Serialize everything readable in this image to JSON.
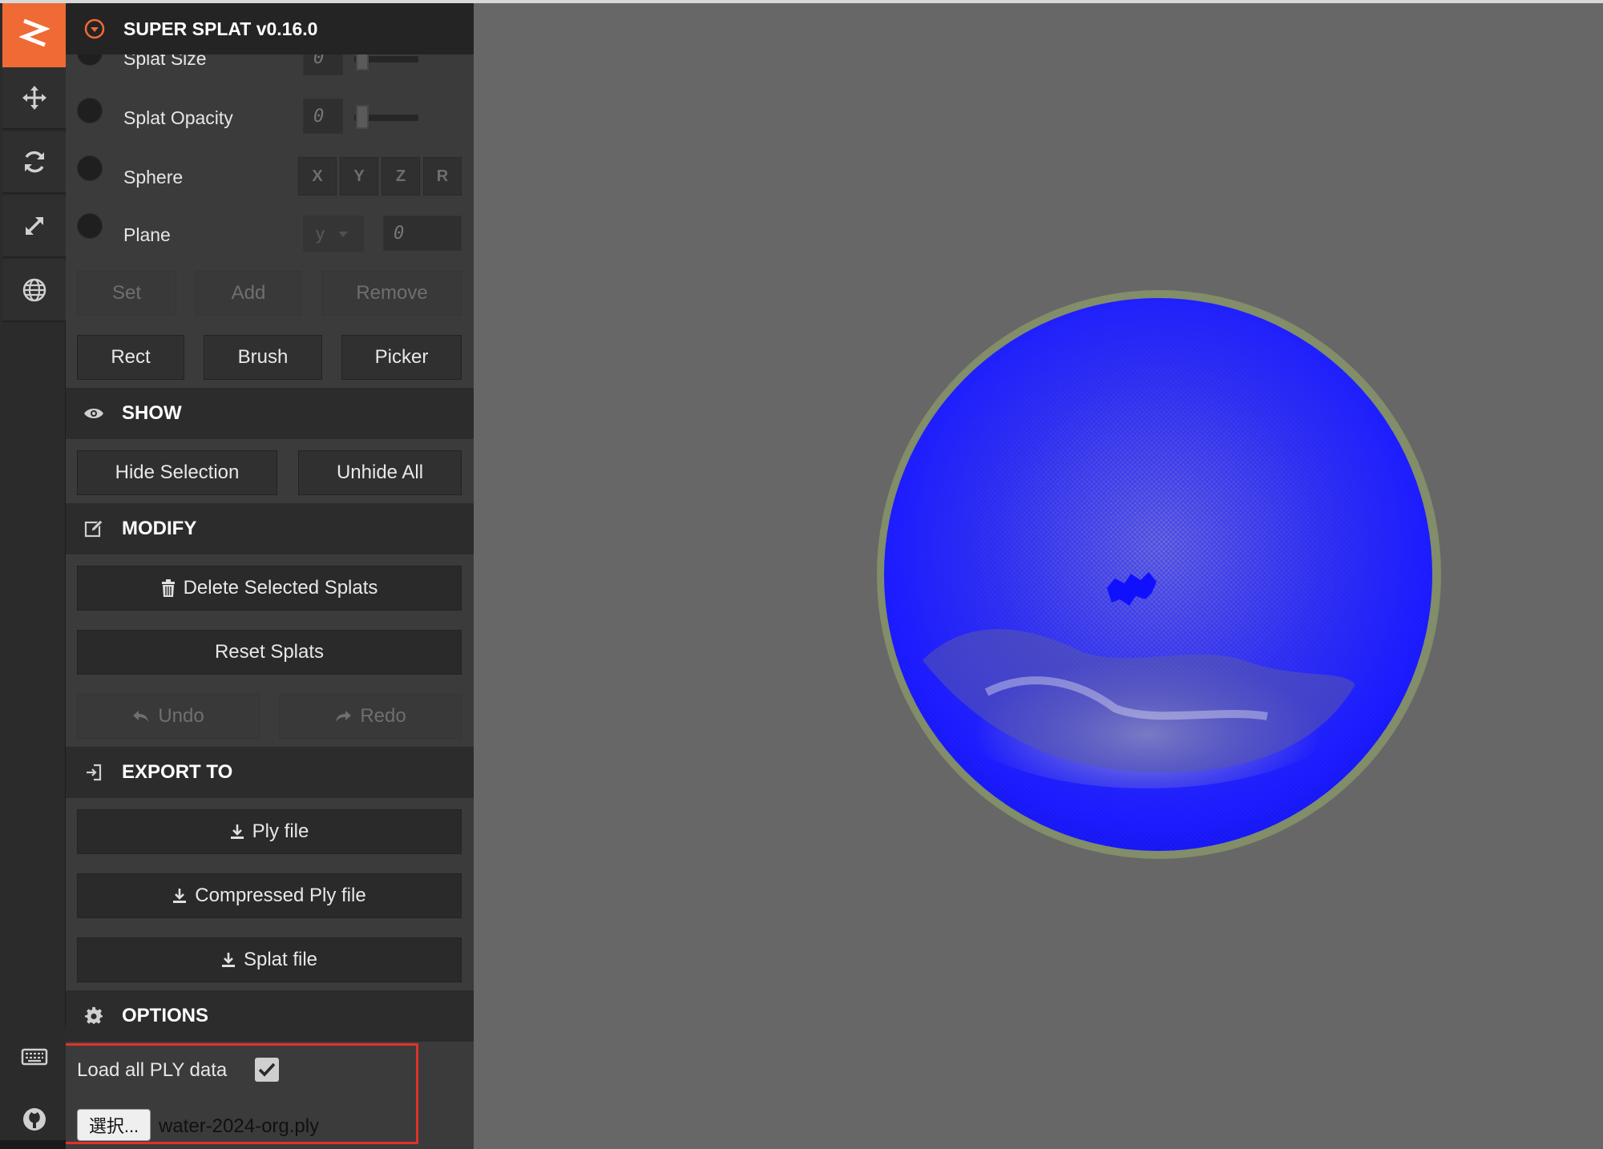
{
  "app": {
    "title": "SUPER SPLAT v0.16.0"
  },
  "toolbar": {
    "items": [
      {
        "icon": "move-icon"
      },
      {
        "icon": "rotate-icon"
      },
      {
        "icon": "scale-icon"
      },
      {
        "icon": "globe-icon"
      }
    ],
    "bottom": [
      {
        "icon": "keyboard-icon"
      },
      {
        "icon": "github-icon"
      }
    ]
  },
  "selection": {
    "splat_size": {
      "label": "Splat Size",
      "value": "0"
    },
    "splat_opacity": {
      "label": "Splat Opacity",
      "value": "0"
    },
    "sphere": {
      "label": "Sphere",
      "axes": [
        "X",
        "Y",
        "Z",
        "R"
      ]
    },
    "plane": {
      "label": "Plane",
      "axis": "y",
      "value": "0"
    },
    "actions": {
      "set": "Set",
      "add": "Add",
      "remove": "Remove"
    },
    "tools": {
      "rect": "Rect",
      "brush": "Brush",
      "picker": "Picker"
    }
  },
  "show": {
    "title": "SHOW",
    "hide_selection": "Hide Selection",
    "unhide_all": "Unhide All"
  },
  "modify": {
    "title": "MODIFY",
    "delete_selected": "Delete Selected Splats",
    "reset": "Reset Splats",
    "undo": "Undo",
    "redo": "Redo"
  },
  "export": {
    "title": "EXPORT TO",
    "ply": "Ply file",
    "compressed_ply": "Compressed Ply file",
    "splat": "Splat file"
  },
  "options": {
    "title": "OPTIONS",
    "load_all_ply_label": "Load all PLY data",
    "load_all_ply_checked": true,
    "file_button": "選択...",
    "file_name": "water-2024-org.ply"
  },
  "colors": {
    "accent": "#f06a36",
    "splat": "#1a1aff",
    "highlight": "#e0322a"
  }
}
